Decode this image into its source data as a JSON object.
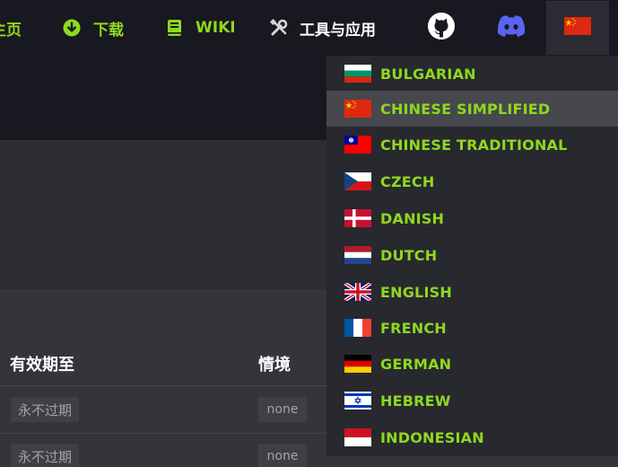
{
  "nav": {
    "home": "主页",
    "download": "下载",
    "wiki": "WIKI",
    "tools": "工具与应用"
  },
  "table": {
    "headers": {
      "expires": "有效期至",
      "context": "情境"
    },
    "rows": [
      {
        "expires": "永不过期",
        "context": "none"
      },
      {
        "expires": "永不过期",
        "context": "none"
      }
    ]
  },
  "languages": [
    {
      "label": "BULGARIAN",
      "flag": "bulgaria"
    },
    {
      "label": "CHINESE SIMPLIFIED",
      "flag": "china"
    },
    {
      "label": "CHINESE TRADITIONAL",
      "flag": "taiwan"
    },
    {
      "label": "CZECH",
      "flag": "czech"
    },
    {
      "label": "DANISH",
      "flag": "denmark"
    },
    {
      "label": "DUTCH",
      "flag": "netherlands"
    },
    {
      "label": "ENGLISH",
      "flag": "uk"
    },
    {
      "label": "FRENCH",
      "flag": "france"
    },
    {
      "label": "GERMAN",
      "flag": "germany"
    },
    {
      "label": "HEBREW",
      "flag": "israel"
    },
    {
      "label": "INDONESIAN",
      "flag": "indonesia"
    }
  ],
  "selected_language": "CHINESE SIMPLIFIED",
  "colors": {
    "accent": "#8ed81e",
    "nav_bg": "#181820",
    "dropdown_bg": "#28282f",
    "active_item_bg": "#47474e"
  }
}
